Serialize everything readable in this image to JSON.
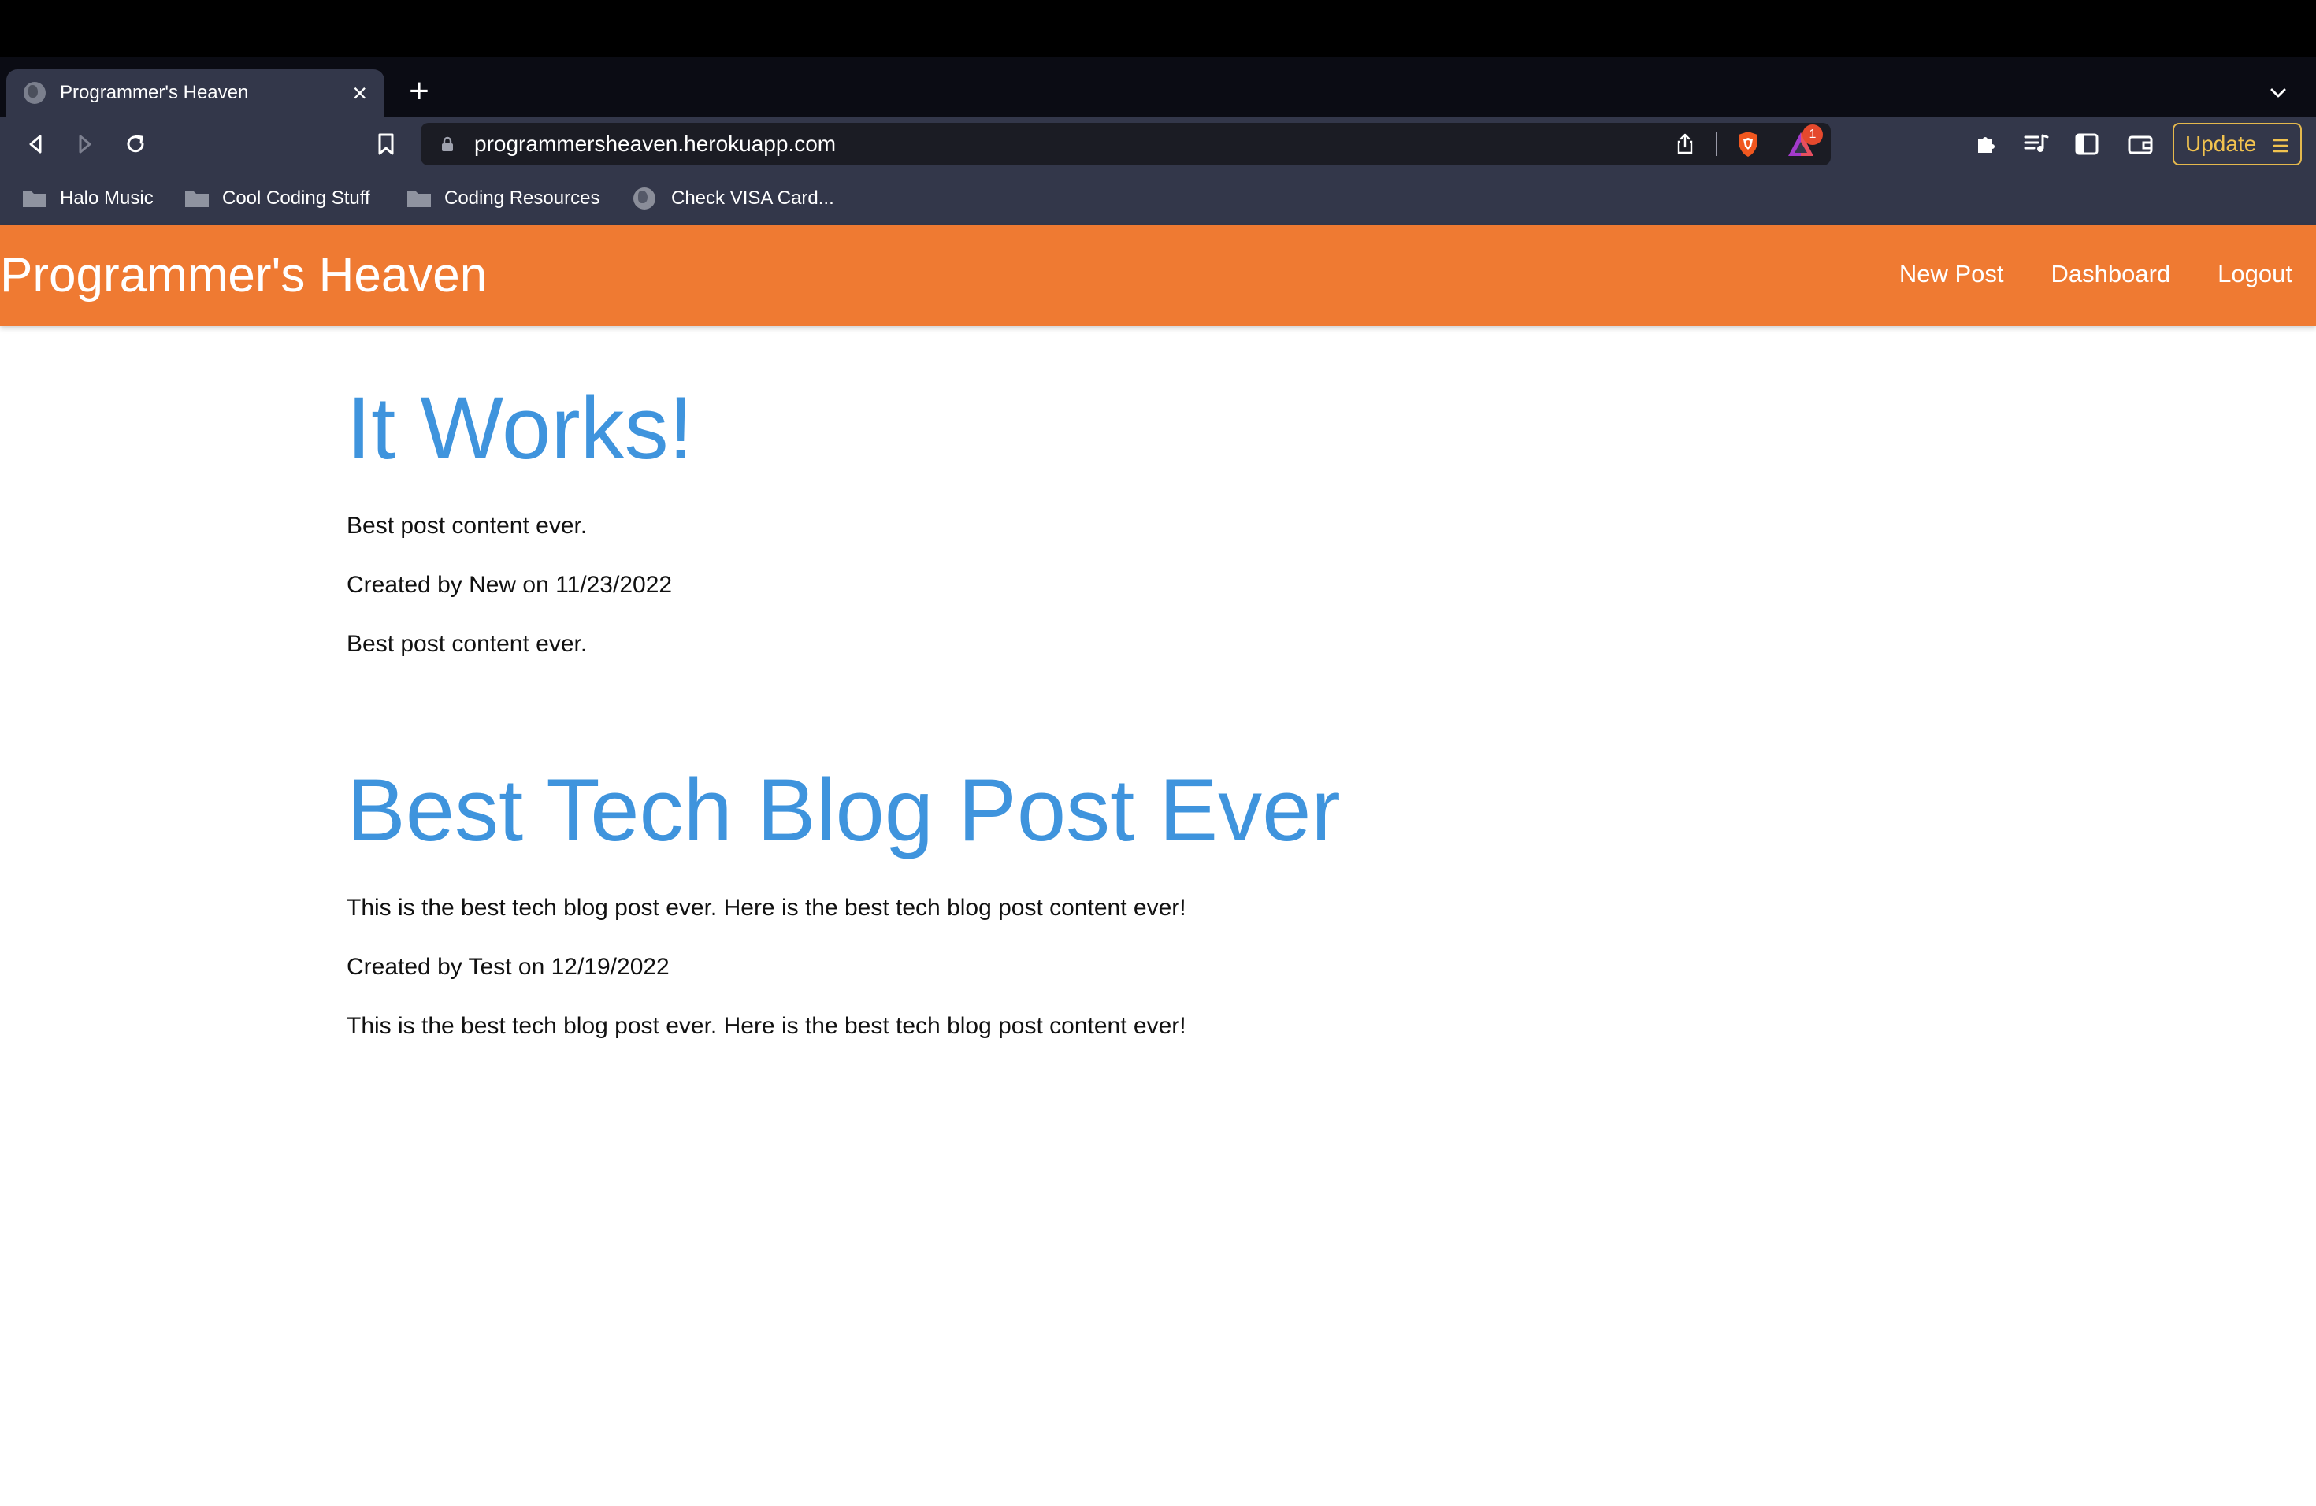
{
  "browser": {
    "tab": {
      "title": "Programmer's Heaven"
    },
    "address_bar": {
      "url": "programmersheaven.herokuapp.com"
    },
    "rewards_badge": "1",
    "update_label": "Update",
    "bookmarks": [
      {
        "label": "Halo Music",
        "icon": "folder-icon"
      },
      {
        "label": "Cool Coding Stuff",
        "icon": "folder-icon"
      },
      {
        "label": "Coding Resources",
        "icon": "folder-icon"
      },
      {
        "label": "Check VISA Card...",
        "icon": "globe-icon"
      }
    ]
  },
  "site": {
    "brand": "Programmer's Heaven",
    "nav": [
      "New Post",
      "Dashboard",
      "Logout"
    ],
    "colors": {
      "navbar": "#ef7a32",
      "post_title": "#3f94dd"
    }
  },
  "posts": [
    {
      "title": "It Works!",
      "content": "Best post content ever.",
      "meta": "Created by New on 11/23/2022",
      "body": "Best post content ever."
    },
    {
      "title": "Best Tech Blog Post Ever",
      "content": "This is the best tech blog post ever. Here is the best tech blog post content ever!",
      "meta": "Created by Test on 12/19/2022",
      "body": "This is the best tech blog post ever. Here is the best tech blog post content ever!"
    }
  ]
}
